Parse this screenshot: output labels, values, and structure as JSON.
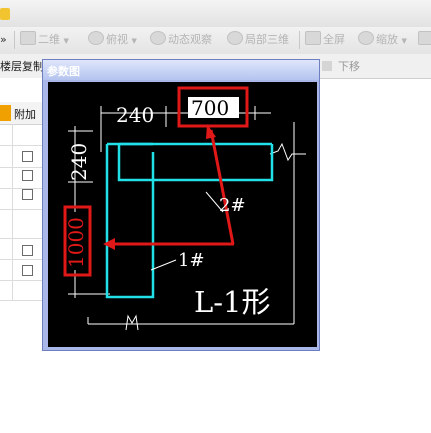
{
  "toolbar": {
    "overflow_label": "»",
    "view2d_label": "二维",
    "view2d_arrow": "▼",
    "fushi_label": "俯视",
    "fushi_arrow": "▼",
    "dynamic_label": "动态观察",
    "local3d_label": "局部三维",
    "fullscreen_label": "全屏",
    "zoom_label": "缩放",
    "zoom_arrow": "▼",
    "extra_label": "平"
  },
  "toolbar2": {
    "floor_copy_label": "楼层复制",
    "move_down_label": "下移"
  },
  "side": {
    "header_label": "附加"
  },
  "dialog": {
    "title": "参数图",
    "dim_top_left": "240",
    "dim_top_input": "700",
    "dim_left_top": "240",
    "dim_left_input": "1000",
    "label_2": "2#",
    "label_1": "1#",
    "shape_label": "L-1形"
  },
  "colors": {
    "bar": "#22e0e8",
    "highlight": "#e01818",
    "canvas": "#000000",
    "dim_line": "#ffffff"
  }
}
